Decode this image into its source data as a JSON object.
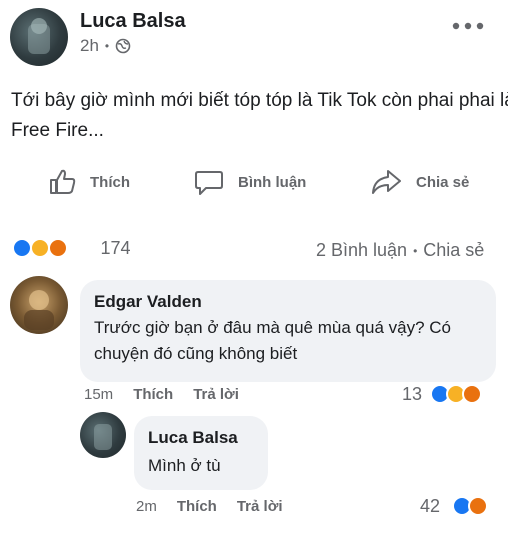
{
  "post": {
    "author": "Luca Balsa",
    "time": "2h",
    "dot": "•",
    "text_line1": "Tới bây giờ mình mới biết tóp tóp là Tik Tok còn phai phai là",
    "text_line2": "Free Fire..."
  },
  "actions": {
    "like": "Thích",
    "comment": "Bình luận",
    "share": "Chia sẻ"
  },
  "stats": {
    "reactions": "174",
    "comments": "2 Bình luận",
    "separator": "•",
    "shares": "Chia sẻ"
  },
  "comment1": {
    "author": "Edgar Valden",
    "text_line1": "Trước giờ bạn ở đâu mà quê mùa quá vậy? Có",
    "text_line2": "chuyện đó cũng không biết",
    "time": "15m",
    "like": "Thích",
    "reply": "Trả lời",
    "reactions": "13"
  },
  "reply1": {
    "author": "Luca Balsa",
    "text": "Mình ở tù",
    "time": "2m",
    "like": "Thích",
    "reply": "Trả lời",
    "reactions": "42"
  },
  "colors": {
    "like": "#1877f2",
    "haha": "#f7b125",
    "angry": "#e9710f",
    "bubble": "#f0f2f5",
    "meta": "#65676b"
  }
}
